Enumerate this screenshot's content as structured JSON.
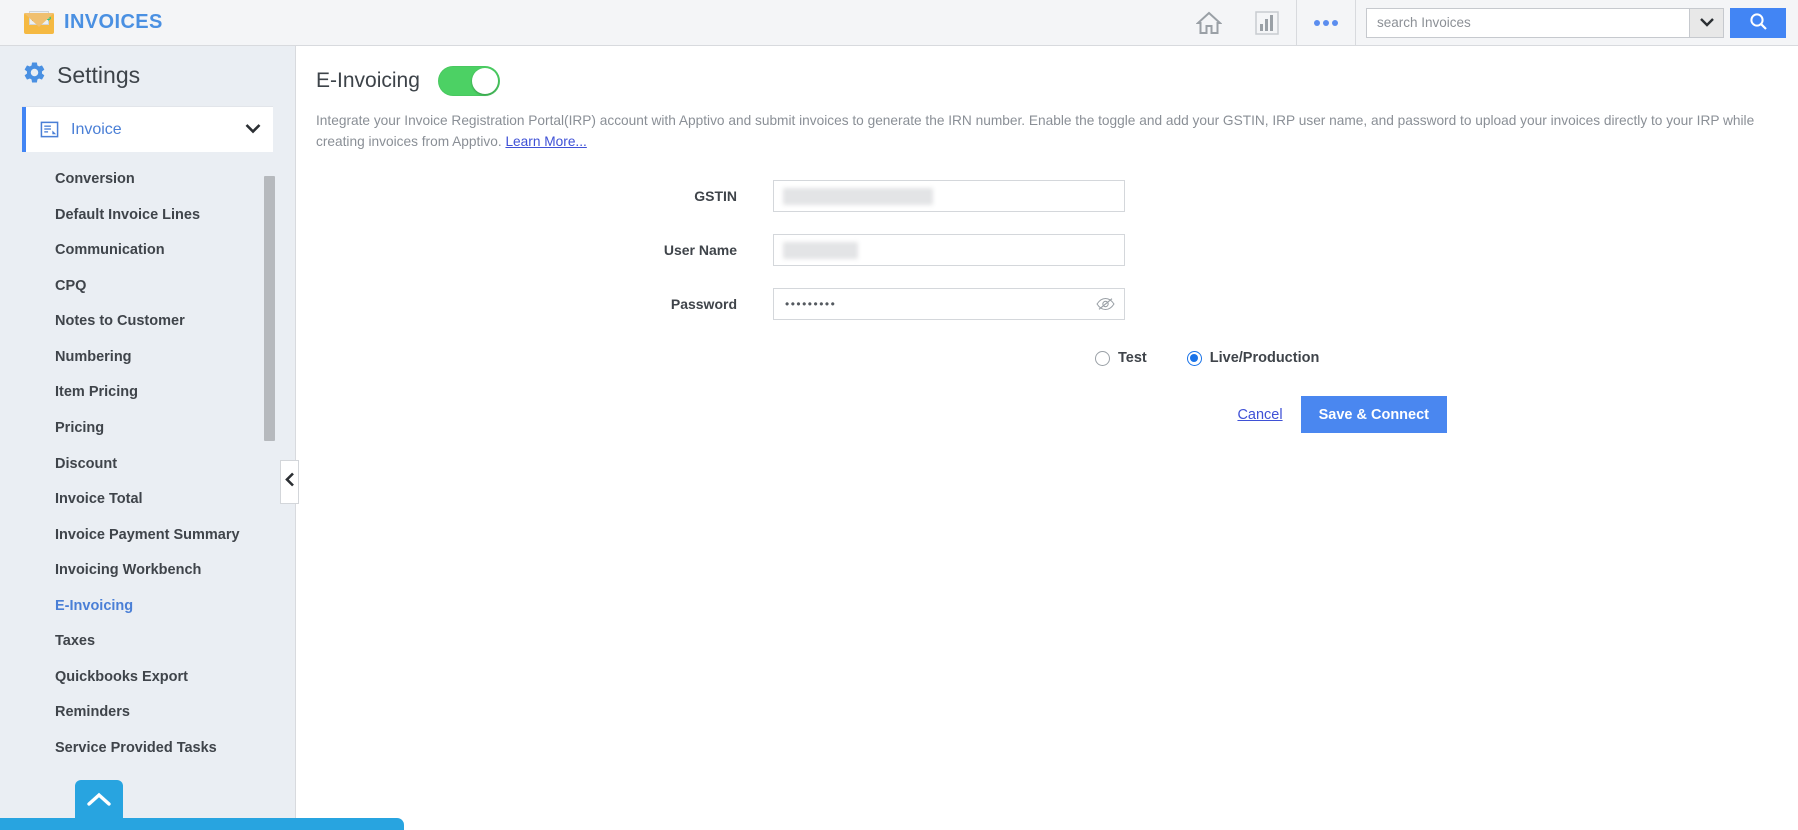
{
  "topbar": {
    "app_title": "INVOICES",
    "app_icon": "invoice-envelope-icon",
    "home_icon": "home-icon",
    "reports_icon": "bar-chart-icon",
    "more_icon": "ellipsis-icon",
    "search": {
      "placeholder": "search Invoices",
      "value": "",
      "dropdown_icon": "chevron-down-icon",
      "button_icon": "search-icon"
    }
  },
  "sidebar": {
    "title": "Settings",
    "gear_icon": "gear-icon",
    "module": {
      "label": "Invoice",
      "icon": "invoice-list-icon",
      "chevron_icon": "chevron-down-icon"
    },
    "items": [
      {
        "label": "Conversion",
        "active": false
      },
      {
        "label": "Default Invoice Lines",
        "active": false
      },
      {
        "label": "Communication",
        "active": false
      },
      {
        "label": "CPQ",
        "active": false
      },
      {
        "label": "Notes to Customer",
        "active": false
      },
      {
        "label": "Numbering",
        "active": false
      },
      {
        "label": "Item Pricing",
        "active": false
      },
      {
        "label": "Pricing",
        "active": false
      },
      {
        "label": "Discount",
        "active": false
      },
      {
        "label": "Invoice Total",
        "active": false
      },
      {
        "label": "Invoice Payment Summary",
        "active": false
      },
      {
        "label": "Invoicing Workbench",
        "active": false
      },
      {
        "label": "E-Invoicing",
        "active": true
      },
      {
        "label": "Taxes",
        "active": false
      },
      {
        "label": "Quickbooks Export",
        "active": false
      },
      {
        "label": "Reminders",
        "active": false
      },
      {
        "label": "Service Provided Tasks",
        "active": false
      }
    ],
    "collapse_icon": "chevron-left-icon",
    "scroll_top_icon": "chevron-up-icon"
  },
  "main": {
    "section_title": "E-Invoicing",
    "toggle_state": "on",
    "description_part1": "Integrate your Invoice Registration Portal(IRP) account with Apptivo and submit invoices to generate the IRN number. Enable the toggle and add your GSTIN, IRP user name, and password to upload your invoices directly to your IRP while creating invoices from Apptivo. ",
    "learn_more": "Learn More...",
    "fields": {
      "gstin_label": "GSTIN",
      "gstin_value": "",
      "username_label": "User Name",
      "username_value": "",
      "password_label": "Password",
      "password_value": "•••••••••",
      "password_toggle_icon": "eye-slash-icon"
    },
    "environment": {
      "test_label": "Test",
      "test_selected": false,
      "live_label": "Live/Production",
      "live_selected": true
    },
    "actions": {
      "cancel_label": "Cancel",
      "save_label": "Save & Connect"
    }
  },
  "colors": {
    "accent_blue": "#4285f4",
    "link_blue": "#3f51d6",
    "toggle_green": "#4cd164",
    "bottom_bar_blue": "#28a4e0"
  }
}
